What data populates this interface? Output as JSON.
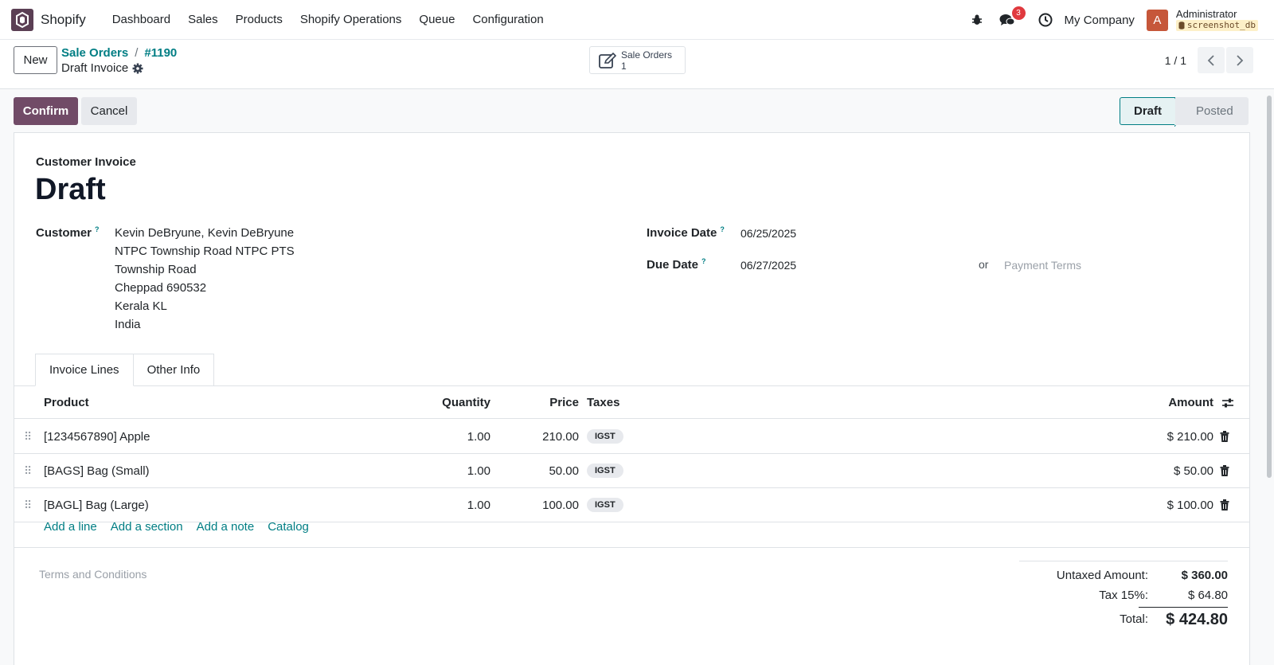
{
  "navbar": {
    "app_name": "Shopify",
    "menu": [
      "Dashboard",
      "Sales",
      "Products",
      "Shopify Operations",
      "Queue",
      "Configuration"
    ],
    "messages_count": "3",
    "company": "My Company",
    "avatar_letter": "A",
    "user": "Administrator",
    "database": "screenshot_db"
  },
  "control": {
    "new_label": "New",
    "breadcrumb_parent": "Sale Orders",
    "breadcrumb_sep": "/",
    "breadcrumb_current": "#1190",
    "record_name": "Draft Invoice",
    "smart_button": {
      "label": "Sale Orders",
      "count": "1"
    },
    "pager": "1 / 1"
  },
  "actions": {
    "confirm": "Confirm",
    "cancel": "Cancel"
  },
  "statusbar": {
    "draft": "Draft",
    "posted": "Posted"
  },
  "form": {
    "doc_type": "Customer Invoice",
    "title": "Draft",
    "customer_label": "Customer",
    "help_mark": "?",
    "customer_address": [
      "Kevin DeBryune, Kevin  DeBryune",
      "NTPC Township Road NTPC PTS",
      "Township Road",
      "Cheppad 690532",
      "Kerala KL",
      "India"
    ],
    "invoice_date_label": "Invoice Date",
    "invoice_date": "06/25/2025",
    "due_date_label": "Due Date",
    "due_date": "06/27/2025",
    "or": "or",
    "payment_terms_placeholder": "Payment Terms"
  },
  "tabs": [
    "Invoice Lines",
    "Other Info"
  ],
  "lines": {
    "headers": {
      "product": "Product",
      "quantity": "Quantity",
      "price": "Price",
      "taxes": "Taxes",
      "amount": "Amount"
    },
    "rows": [
      {
        "product": "[1234567890] Apple",
        "quantity": "1.00",
        "price": "210.00",
        "tax": "IGST",
        "amount": "$ 210.00"
      },
      {
        "product": "[BAGS] Bag (Small)",
        "quantity": "1.00",
        "price": "50.00",
        "tax": "IGST",
        "amount": "$ 50.00"
      },
      {
        "product": "[BAGL] Bag (Large)",
        "quantity": "1.00",
        "price": "100.00",
        "tax": "IGST",
        "amount": "$ 100.00"
      }
    ],
    "add_line": "Add a line",
    "add_section": "Add a section",
    "add_note": "Add a note",
    "catalog": "Catalog"
  },
  "footer": {
    "terms_placeholder": "Terms and Conditions",
    "untaxed_label": "Untaxed Amount:",
    "untaxed_value": "$ 360.00",
    "tax_label": "Tax 15%:",
    "tax_value": "$ 64.80",
    "total_label": "Total:",
    "total_value": "$ 424.80"
  },
  "colors": {
    "brand": "#714b67",
    "link": "#017e84",
    "badge": "#e0393e"
  }
}
